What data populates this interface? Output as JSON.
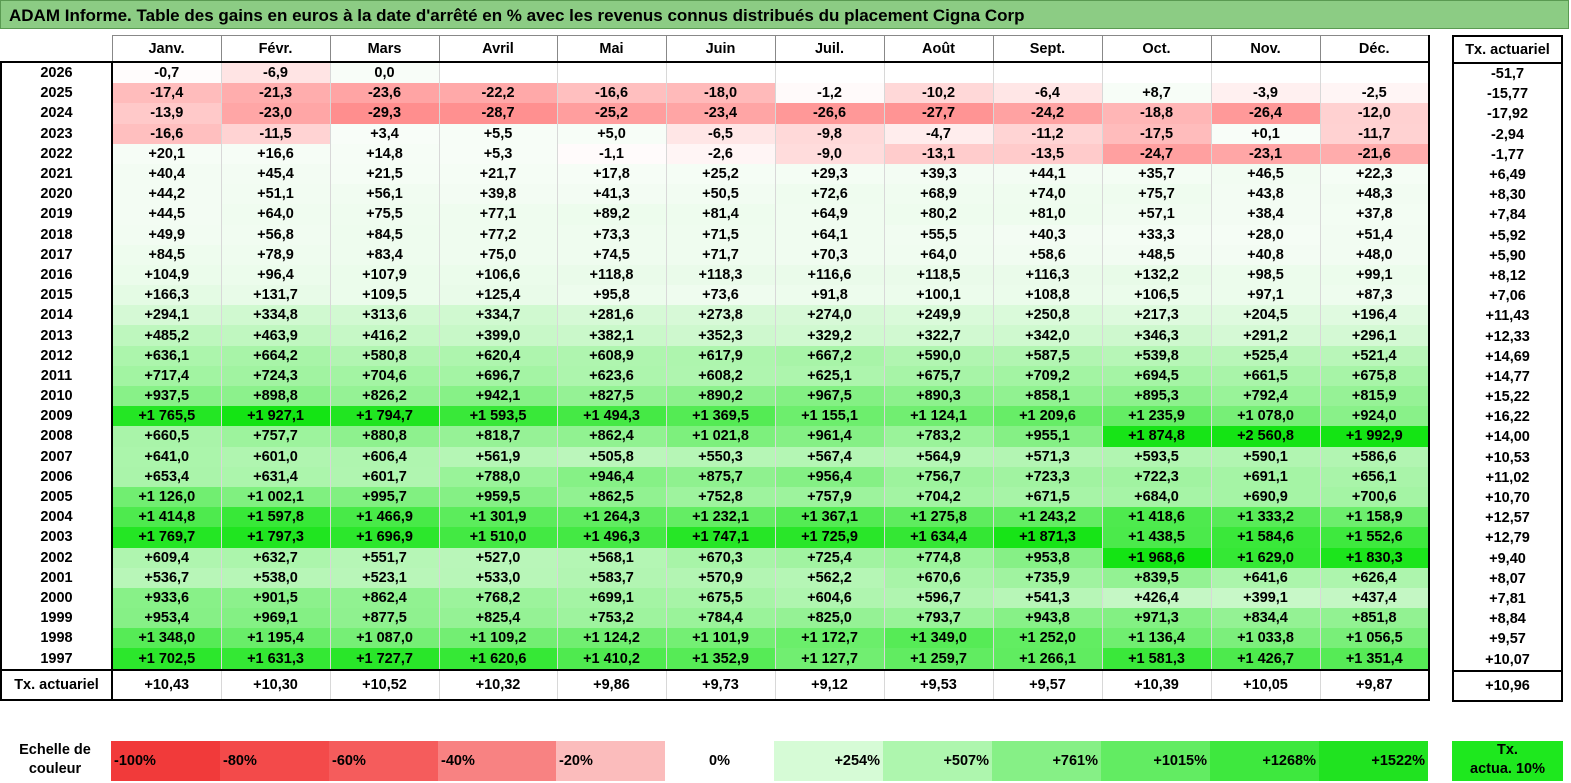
{
  "title": "ADAM Informe. Table des gains en euros à la date d'arrêté en % avec les revenus connus distribués du placement Cigna Corp",
  "months": [
    "Janv.",
    "Févr.",
    "Mars",
    "Avril",
    "Mai",
    "Juin",
    "Juil.",
    "Août",
    "Sept.",
    "Oct.",
    "Nov.",
    "Déc."
  ],
  "actu_header": "Tx. actuariel",
  "rows": [
    {
      "year": "2026",
      "values": [
        "-0,7",
        "-6,9",
        "0,0",
        "",
        "",
        "",
        "",
        "",
        "",
        "",
        "",
        ""
      ],
      "actu": "-51,7"
    },
    {
      "year": "2025",
      "values": [
        "-17,4",
        "-21,3",
        "-23,6",
        "-22,2",
        "-16,6",
        "-18,0",
        "-1,2",
        "-10,2",
        "-6,4",
        "+8,7",
        "-3,9",
        "-2,5"
      ],
      "actu": "-15,77"
    },
    {
      "year": "2024",
      "values": [
        "-13,9",
        "-23,0",
        "-29,3",
        "-28,7",
        "-25,2",
        "-23,4",
        "-26,6",
        "-27,7",
        "-24,2",
        "-18,8",
        "-26,4",
        "-12,0"
      ],
      "actu": "-17,92"
    },
    {
      "year": "2023",
      "values": [
        "-16,6",
        "-11,5",
        "+3,4",
        "+5,5",
        "+5,0",
        "-6,5",
        "-9,8",
        "-4,7",
        "-11,2",
        "-17,5",
        "+0,1",
        "-11,7"
      ],
      "actu": "-2,94"
    },
    {
      "year": "2022",
      "values": [
        "+20,1",
        "+16,6",
        "+14,8",
        "+5,3",
        "-1,1",
        "-2,6",
        "-9,0",
        "-13,1",
        "-13,5",
        "-24,7",
        "-23,1",
        "-21,6"
      ],
      "actu": "-1,77"
    },
    {
      "year": "2021",
      "values": [
        "+40,4",
        "+45,4",
        "+21,5",
        "+21,7",
        "+17,8",
        "+25,2",
        "+29,3",
        "+39,3",
        "+44,1",
        "+35,7",
        "+46,5",
        "+22,3"
      ],
      "actu": "+6,49"
    },
    {
      "year": "2020",
      "values": [
        "+44,2",
        "+51,1",
        "+56,1",
        "+39,8",
        "+41,3",
        "+50,5",
        "+72,6",
        "+68,9",
        "+74,0",
        "+75,7",
        "+43,8",
        "+48,3"
      ],
      "actu": "+8,30"
    },
    {
      "year": "2019",
      "values": [
        "+44,5",
        "+64,0",
        "+75,5",
        "+77,1",
        "+89,2",
        "+81,4",
        "+64,9",
        "+80,2",
        "+81,0",
        "+57,1",
        "+38,4",
        "+37,8"
      ],
      "actu": "+7,84"
    },
    {
      "year": "2018",
      "values": [
        "+49,9",
        "+56,8",
        "+84,5",
        "+77,2",
        "+73,3",
        "+71,5",
        "+64,1",
        "+55,5",
        "+40,3",
        "+33,3",
        "+28,0",
        "+51,4"
      ],
      "actu": "+5,92"
    },
    {
      "year": "2017",
      "values": [
        "+84,5",
        "+78,9",
        "+83,4",
        "+75,0",
        "+74,5",
        "+71,7",
        "+70,3",
        "+64,0",
        "+58,6",
        "+48,5",
        "+40,8",
        "+48,0"
      ],
      "actu": "+5,90"
    },
    {
      "year": "2016",
      "values": [
        "+104,9",
        "+96,4",
        "+107,9",
        "+106,6",
        "+118,8",
        "+118,3",
        "+116,6",
        "+118,5",
        "+116,3",
        "+132,2",
        "+98,5",
        "+99,1"
      ],
      "actu": "+8,12"
    },
    {
      "year": "2015",
      "values": [
        "+166,3",
        "+131,7",
        "+109,5",
        "+125,4",
        "+95,8",
        "+73,6",
        "+91,8",
        "+100,1",
        "+108,8",
        "+106,5",
        "+97,1",
        "+87,3"
      ],
      "actu": "+7,06"
    },
    {
      "year": "2014",
      "values": [
        "+294,1",
        "+334,8",
        "+313,6",
        "+334,7",
        "+281,6",
        "+273,8",
        "+274,0",
        "+249,9",
        "+250,8",
        "+217,3",
        "+204,5",
        "+196,4"
      ],
      "actu": "+11,43"
    },
    {
      "year": "2013",
      "values": [
        "+485,2",
        "+463,9",
        "+416,2",
        "+399,0",
        "+382,1",
        "+352,3",
        "+329,2",
        "+322,7",
        "+342,0",
        "+346,3",
        "+291,2",
        "+296,1"
      ],
      "actu": "+12,33"
    },
    {
      "year": "2012",
      "values": [
        "+636,1",
        "+664,2",
        "+580,8",
        "+620,4",
        "+608,9",
        "+617,9",
        "+667,2",
        "+590,0",
        "+587,5",
        "+539,8",
        "+525,4",
        "+521,4"
      ],
      "actu": "+14,69"
    },
    {
      "year": "2011",
      "values": [
        "+717,4",
        "+724,3",
        "+704,6",
        "+696,7",
        "+623,6",
        "+608,2",
        "+625,1",
        "+675,7",
        "+709,2",
        "+694,5",
        "+661,5",
        "+675,8"
      ],
      "actu": "+14,77"
    },
    {
      "year": "2010",
      "values": [
        "+937,5",
        "+898,8",
        "+826,2",
        "+942,1",
        "+827,5",
        "+890,2",
        "+967,5",
        "+890,3",
        "+858,1",
        "+895,3",
        "+792,4",
        "+815,9"
      ],
      "actu": "+15,22"
    },
    {
      "year": "2009",
      "values": [
        "+1 765,5",
        "+1 927,1",
        "+1 794,7",
        "+1 593,5",
        "+1 494,3",
        "+1 369,5",
        "+1 155,1",
        "+1 124,1",
        "+1 209,6",
        "+1 235,9",
        "+1 078,0",
        "+924,0"
      ],
      "actu": "+16,22"
    },
    {
      "year": "2008",
      "values": [
        "+660,5",
        "+757,7",
        "+880,8",
        "+818,7",
        "+862,4",
        "+1 021,8",
        "+961,4",
        "+783,2",
        "+955,1",
        "+1 874,8",
        "+2 560,8",
        "+1 992,9"
      ],
      "actu": "+14,00"
    },
    {
      "year": "2007",
      "values": [
        "+641,0",
        "+601,0",
        "+606,4",
        "+561,9",
        "+505,8",
        "+550,3",
        "+567,4",
        "+564,9",
        "+571,3",
        "+593,5",
        "+590,1",
        "+586,6"
      ],
      "actu": "+10,53"
    },
    {
      "year": "2006",
      "values": [
        "+653,4",
        "+631,4",
        "+601,7",
        "+788,0",
        "+946,4",
        "+875,7",
        "+956,4",
        "+756,7",
        "+723,3",
        "+722,3",
        "+691,1",
        "+656,1"
      ],
      "actu": "+11,02"
    },
    {
      "year": "2005",
      "values": [
        "+1 126,0",
        "+1 002,1",
        "+995,7",
        "+959,5",
        "+862,5",
        "+752,8",
        "+757,9",
        "+704,2",
        "+671,5",
        "+684,0",
        "+690,9",
        "+700,6"
      ],
      "actu": "+10,70"
    },
    {
      "year": "2004",
      "values": [
        "+1 414,8",
        "+1 597,8",
        "+1 466,9",
        "+1 301,9",
        "+1 264,3",
        "+1 232,1",
        "+1 367,1",
        "+1 275,8",
        "+1 243,2",
        "+1 418,6",
        "+1 333,2",
        "+1 158,9"
      ],
      "actu": "+12,57"
    },
    {
      "year": "2003",
      "values": [
        "+1 769,7",
        "+1 797,3",
        "+1 696,9",
        "+1 510,0",
        "+1 496,3",
        "+1 747,1",
        "+1 725,9",
        "+1 634,4",
        "+1 871,3",
        "+1 438,5",
        "+1 584,6",
        "+1 552,6"
      ],
      "actu": "+12,79"
    },
    {
      "year": "2002",
      "values": [
        "+609,4",
        "+632,7",
        "+551,7",
        "+527,0",
        "+568,1",
        "+670,3",
        "+725,4",
        "+774,8",
        "+953,8",
        "+1 968,6",
        "+1 629,0",
        "+1 830,3"
      ],
      "actu": "+9,40"
    },
    {
      "year": "2001",
      "values": [
        "+536,7",
        "+538,0",
        "+523,1",
        "+533,0",
        "+583,7",
        "+570,9",
        "+562,2",
        "+670,6",
        "+735,9",
        "+839,5",
        "+641,6",
        "+626,4"
      ],
      "actu": "+8,07"
    },
    {
      "year": "2000",
      "values": [
        "+933,6",
        "+901,5",
        "+862,4",
        "+768,2",
        "+699,1",
        "+675,5",
        "+604,6",
        "+596,7",
        "+541,3",
        "+426,4",
        "+399,1",
        "+437,4"
      ],
      "actu": "+7,81"
    },
    {
      "year": "1999",
      "values": [
        "+953,4",
        "+969,1",
        "+877,5",
        "+825,4",
        "+753,2",
        "+784,4",
        "+825,0",
        "+793,7",
        "+943,8",
        "+971,3",
        "+834,4",
        "+851,8"
      ],
      "actu": "+8,84"
    },
    {
      "year": "1998",
      "values": [
        "+1 348,0",
        "+1 195,4",
        "+1 087,0",
        "+1 109,2",
        "+1 124,2",
        "+1 101,9",
        "+1 172,7",
        "+1 349,0",
        "+1 252,0",
        "+1 136,4",
        "+1 033,8",
        "+1 056,5"
      ],
      "actu": "+9,57"
    },
    {
      "year": "1997",
      "values": [
        "+1 702,5",
        "+1 631,3",
        "+1 727,7",
        "+1 620,6",
        "+1 410,2",
        "+1 352,9",
        "+1 127,7",
        "+1 259,7",
        "+1 266,1",
        "+1 581,3",
        "+1 426,7",
        "+1 351,4"
      ],
      "actu": "+10,07"
    }
  ],
  "footer": {
    "label": "Tx. actuariel",
    "values": [
      "+10,43",
      "+10,30",
      "+10,52",
      "+10,32",
      "+9,86",
      "+9,73",
      "+9,12",
      "+9,53",
      "+9,57",
      "+10,39",
      "+10,05",
      "+9,87"
    ],
    "actu": "+10,96"
  },
  "scale": {
    "label_line1": "Echelle de",
    "label_line2": "couleur",
    "cells": [
      {
        "label": "-100%",
        "color": "#f13a3a",
        "align": "left"
      },
      {
        "label": "-80%",
        "color": "#f34a4a",
        "align": "left"
      },
      {
        "label": "-60%",
        "color": "#f55c5c",
        "align": "left"
      },
      {
        "label": "-40%",
        "color": "#f88282",
        "align": "left"
      },
      {
        "label": "-20%",
        "color": "#fbbcbc",
        "align": "left"
      },
      {
        "label": "0%",
        "color": "#ffffff",
        "align": "center"
      },
      {
        "label": "+254%",
        "color": "#d6fbd6",
        "align": "right"
      },
      {
        "label": "+507%",
        "color": "#aef6ae",
        "align": "right"
      },
      {
        "label": "+761%",
        "color": "#86f086",
        "align": "right"
      },
      {
        "label": "+1015%",
        "color": "#62ec62",
        "align": "right"
      },
      {
        "label": "+1268%",
        "color": "#3ee83e",
        "align": "right"
      },
      {
        "label": "+1522%",
        "color": "#20e320",
        "align": "right"
      }
    ],
    "actu_line1": "Tx.",
    "actu_line2": "actua. 10%"
  }
}
